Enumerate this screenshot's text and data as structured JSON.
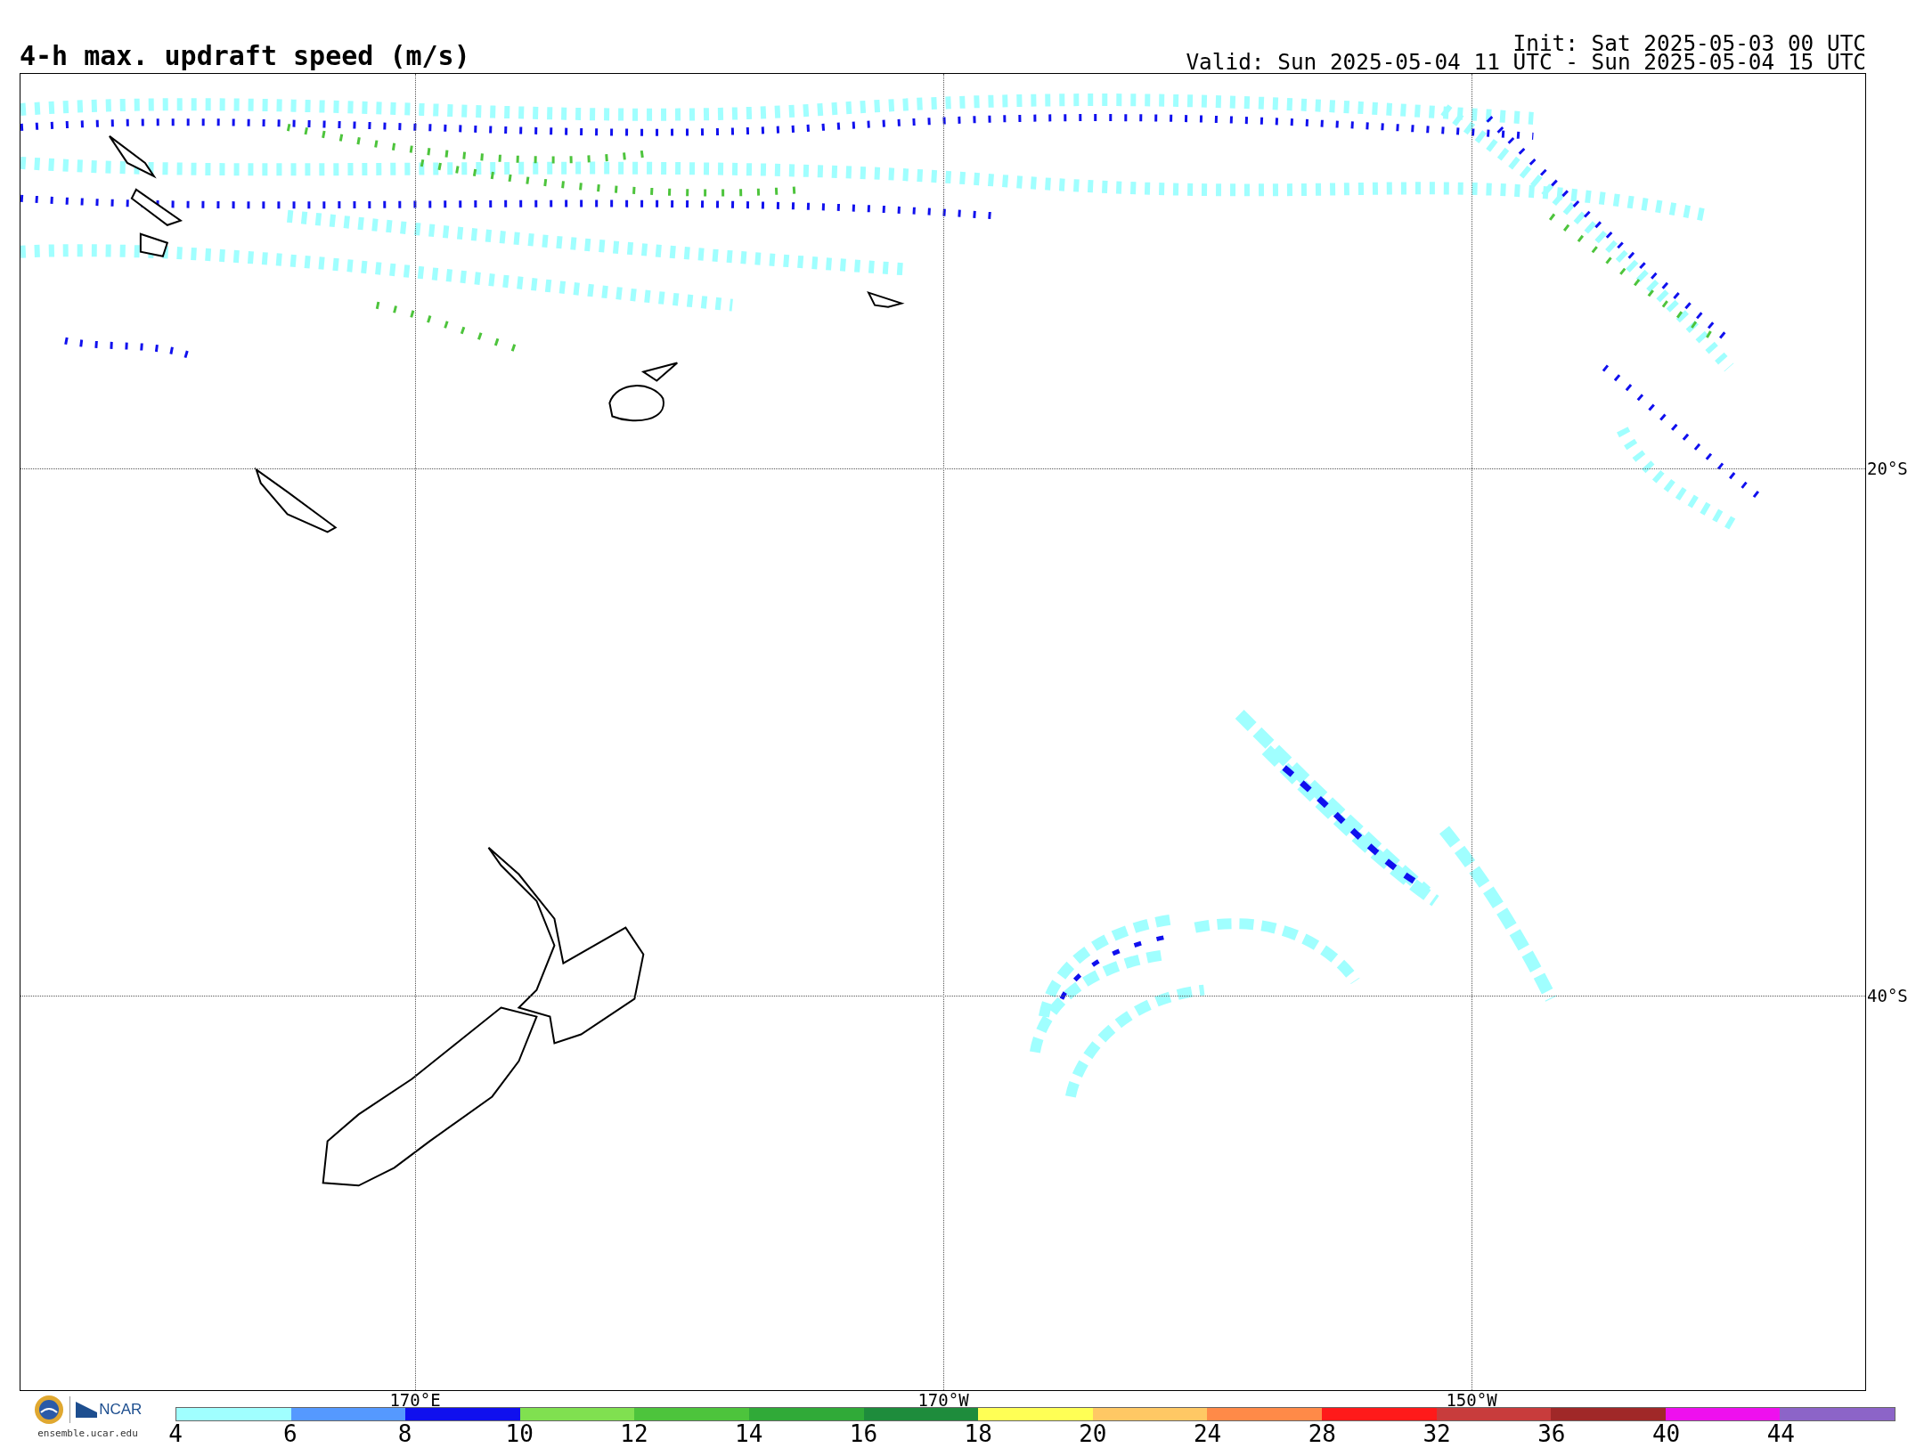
{
  "title": "4-h max. updraft speed (m/s)",
  "init": "Init: Sat 2025-05-03 00 UTC",
  "valid": "Valid: Sun 2025-05-04 11 UTC - Sun 2025-05-04 15 UTC",
  "map": {
    "longitude_labels": [
      "170°E",
      "170°W",
      "150°W"
    ],
    "latitude_labels": [
      "20°S",
      "40°S"
    ]
  },
  "colorbar": [
    {
      "label": "4",
      "color": "#a0ffff"
    },
    {
      "label": "6",
      "color": "#5599ff"
    },
    {
      "label": "8",
      "color": "#1010ee"
    },
    {
      "label": "10",
      "color": "#80e050"
    },
    {
      "label": "12",
      "color": "#4dc43c"
    },
    {
      "label": "14",
      "color": "#30aa38"
    },
    {
      "label": "16",
      "color": "#1e8c3c"
    },
    {
      "label": "18",
      "color": "#ffff55"
    },
    {
      "label": "20",
      "color": "#ffc864"
    },
    {
      "label": "24",
      "color": "#ff8a48"
    },
    {
      "label": "28",
      "color": "#ff1a1a"
    },
    {
      "label": "32",
      "color": "#c83c3c"
    },
    {
      "label": "36",
      "color": "#a02828"
    },
    {
      "label": "40",
      "color": "#ee10ee"
    },
    {
      "label": "44",
      "color": "#8c64c8"
    }
  ],
  "logo": {
    "org": "NCAR",
    "url": "ensemble.ucar.edu"
  }
}
